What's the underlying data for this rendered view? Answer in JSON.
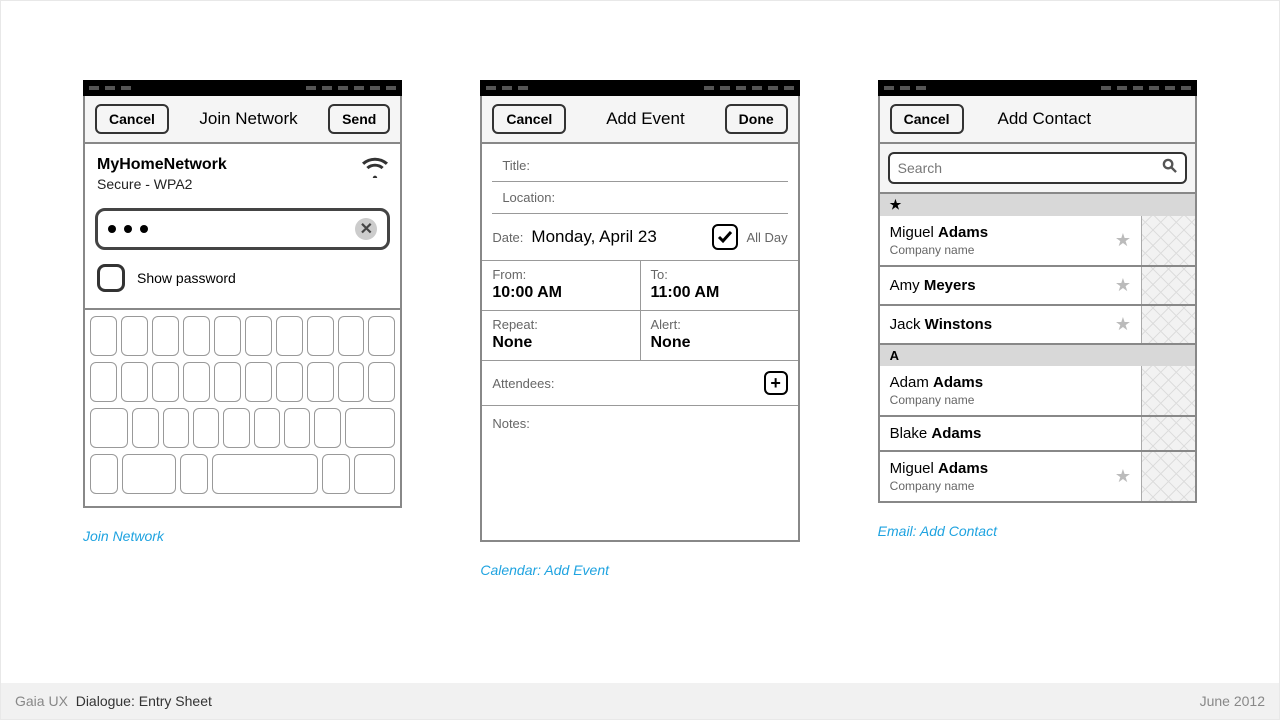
{
  "panel1": {
    "header": {
      "cancel": "Cancel",
      "title": "Join Network",
      "send": "Send"
    },
    "network_name": "MyHomeNetwork",
    "security": "Secure - WPA2",
    "show_password": "Show password",
    "caption": "Join Network"
  },
  "panel2": {
    "header": {
      "cancel": "Cancel",
      "title": "Add Event",
      "done": "Done"
    },
    "title_label": "Title:",
    "location_label": "Location:",
    "date_label": "Date:",
    "date_value": "Monday, April 23",
    "allday": "All Day",
    "from_label": "From:",
    "from_value": "10:00 AM",
    "to_label": "To:",
    "to_value": "11:00 AM",
    "repeat_label": "Repeat:",
    "repeat_value": "None",
    "alert_label": "Alert:",
    "alert_value": "None",
    "attendees_label": "Attendees:",
    "notes_label": "Notes:",
    "caption": "Calendar: Add Event"
  },
  "panel3": {
    "header": {
      "cancel": "Cancel",
      "title": "Add Contact"
    },
    "search_placeholder": "Search",
    "section_star": "★",
    "section_a": "A",
    "contacts_fav": [
      {
        "first": "Miguel",
        "last": "Adams",
        "company": "Company name",
        "star": true
      },
      {
        "first": "Amy",
        "last": "Meyers",
        "company": "",
        "star": true
      },
      {
        "first": "Jack",
        "last": "Winstons",
        "company": "",
        "star": true
      }
    ],
    "contacts_a": [
      {
        "first": "Adam",
        "last": "Adams",
        "company": "Company name",
        "star": false
      },
      {
        "first": "Blake",
        "last": "Adams",
        "company": "",
        "star": false
      },
      {
        "first": "Miguel",
        "last": "Adams",
        "company": "Company name",
        "star": true
      }
    ],
    "caption": "Email: Add Contact"
  },
  "footer": {
    "left_gray": "Gaia UX",
    "left_title": "Dialogue: Entry Sheet",
    "right": "June 2012"
  }
}
